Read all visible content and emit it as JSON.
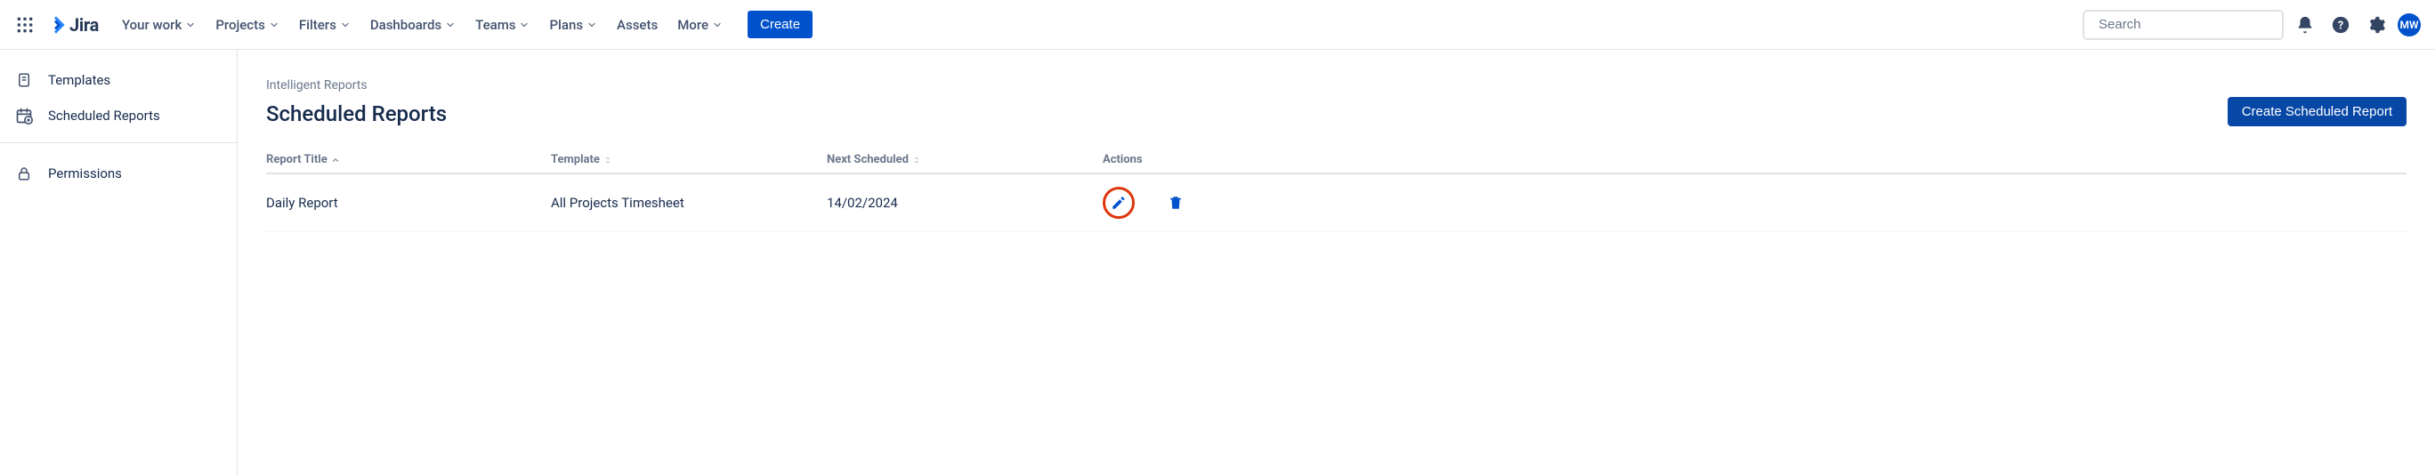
{
  "topnav": {
    "logo_text": "Jira",
    "items": [
      {
        "label": "Your work",
        "has_chevron": true
      },
      {
        "label": "Projects",
        "has_chevron": true
      },
      {
        "label": "Filters",
        "has_chevron": true
      },
      {
        "label": "Dashboards",
        "has_chevron": true
      },
      {
        "label": "Teams",
        "has_chevron": true
      },
      {
        "label": "Plans",
        "has_chevron": true
      },
      {
        "label": "Assets",
        "has_chevron": false
      },
      {
        "label": "More",
        "has_chevron": true
      }
    ],
    "create_label": "Create",
    "search_placeholder": "Search",
    "avatar_initials": "MW"
  },
  "sidebar": {
    "group1": [
      {
        "label": "Templates",
        "icon": "document"
      },
      {
        "label": "Scheduled Reports",
        "icon": "calendar-plus"
      }
    ],
    "group2": [
      {
        "label": "Permissions",
        "icon": "lock"
      }
    ]
  },
  "main": {
    "breadcrumb": "Intelligent Reports",
    "title": "Scheduled Reports",
    "create_btn": "Create Scheduled Report",
    "columns": {
      "report_title": "Report Title",
      "template": "Template",
      "next_scheduled": "Next Scheduled",
      "actions": "Actions"
    },
    "rows": [
      {
        "report_title": "Daily Report",
        "template": "All Projects Timesheet",
        "next_scheduled": "14/02/2024"
      }
    ]
  },
  "colors": {
    "primary": "#0052CC",
    "primary_dark": "#0747A6",
    "danger": "#DE350B",
    "text": "#172B4D",
    "text_subtle": "#6B778C"
  }
}
